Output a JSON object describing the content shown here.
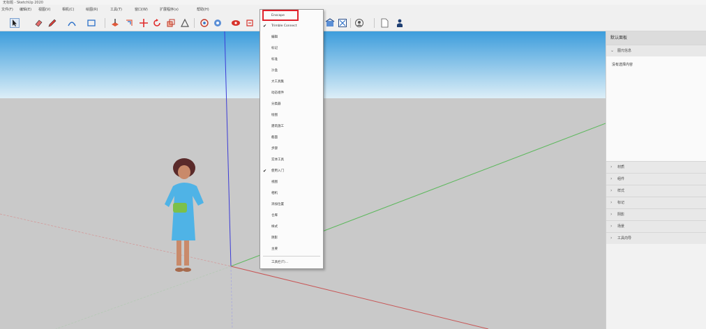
{
  "window": {
    "title": "无标题 - SketchUp 2020"
  },
  "menubar": [
    "文件(F)",
    "编辑(E)",
    "视图(V)",
    "相机(C)",
    "绘图(R)",
    "工具(T)",
    "窗口(W)",
    "扩展程序(x)",
    "帮助(H)"
  ],
  "toolbar_icons": [
    "select-icon",
    "eraser-icon",
    "pencil-icon",
    "arc-icon",
    "rectangle-icon",
    "push-pull-icon",
    "move-icon",
    "rotate-icon",
    "scale-icon",
    "offset-icon",
    "tape-icon",
    "orbit-icon",
    "pan-icon",
    "zoom-icon",
    "zoom-extents-icon",
    "warehouse-icon",
    "extension-icon",
    "account-icon",
    "new-file-icon",
    "person-icon"
  ],
  "toolbar_menu": {
    "highlighted_item": "Enscape",
    "items": [
      {
        "label": "Enscape",
        "checked": false
      },
      {
        "label": "Trimble Connect",
        "checked": true
      },
      {
        "label": "编辑",
        "checked": false
      },
      {
        "label": "标记",
        "checked": false
      },
      {
        "label": "标准",
        "checked": false
      },
      {
        "label": "沙盒",
        "checked": false
      },
      {
        "label": "大工具集",
        "checked": false
      },
      {
        "label": "动态组件",
        "checked": false
      },
      {
        "label": "分类器",
        "checked": false
      },
      {
        "label": "绘图",
        "checked": false
      },
      {
        "label": "建筑施工",
        "checked": false
      },
      {
        "label": "截面",
        "checked": false
      },
      {
        "label": "步骤",
        "checked": false
      },
      {
        "label": "实体工具",
        "checked": false
      },
      {
        "label": "使用入门",
        "checked": true
      },
      {
        "label": "视图",
        "checked": false
      },
      {
        "label": "相机",
        "checked": false
      },
      {
        "label": "添加位置",
        "checked": false
      },
      {
        "label": "仓库",
        "checked": false
      },
      {
        "label": "样式",
        "checked": false
      },
      {
        "label": "阴影",
        "checked": false
      },
      {
        "label": "主要",
        "checked": false
      }
    ],
    "footer_item": "工具栏(T)..."
  },
  "tray": {
    "title": "默认面板",
    "entity_info": {
      "label": "图元信息",
      "body": "没有选择内容"
    },
    "sections": [
      "材质",
      "组件",
      "样式",
      "标记",
      "阴影",
      "场景",
      "工具向导"
    ]
  },
  "colors": {
    "sky_top": "#4aa3de",
    "sky_bottom": "#d6ecf6",
    "ground": "#c9c9c9",
    "axis_red": "#c0504d",
    "axis_green": "#4caf50",
    "axis_blue": "#3b3bd6",
    "highlight": "#e0212b"
  }
}
